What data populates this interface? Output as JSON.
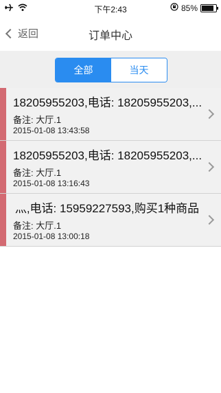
{
  "status_bar": {
    "time": "下午2:43",
    "battery": "85%",
    "battery_level": 0.85,
    "icons": [
      "airplane-icon",
      "wifi-icon",
      "lock-rotation-icon",
      "battery-icon"
    ]
  },
  "nav": {
    "back_label": "返回",
    "title": "订单中心"
  },
  "segments": {
    "all_label": "全部",
    "today_label": "当天",
    "selected": "全部"
  },
  "orders": [
    {
      "title": "18205955203,电话: 18205955203,...",
      "note": "备注: 大厅.1",
      "time": "2015-01-08 13:43:58"
    },
    {
      "title": "18205955203,电话: 18205955203,...",
      "note": "备注: 大厅.1",
      "time": "2015-01-08 13:16:43"
    },
    {
      "title": " 灬,电话: 15959227593,购买1种商品",
      "note": "备注: 大厅.1",
      "time": "2015-01-08 13:00:18"
    }
  ],
  "colors": {
    "accent": "#2a8cf0",
    "order_marker": "#d36a72",
    "header_bg": "#efefef"
  }
}
